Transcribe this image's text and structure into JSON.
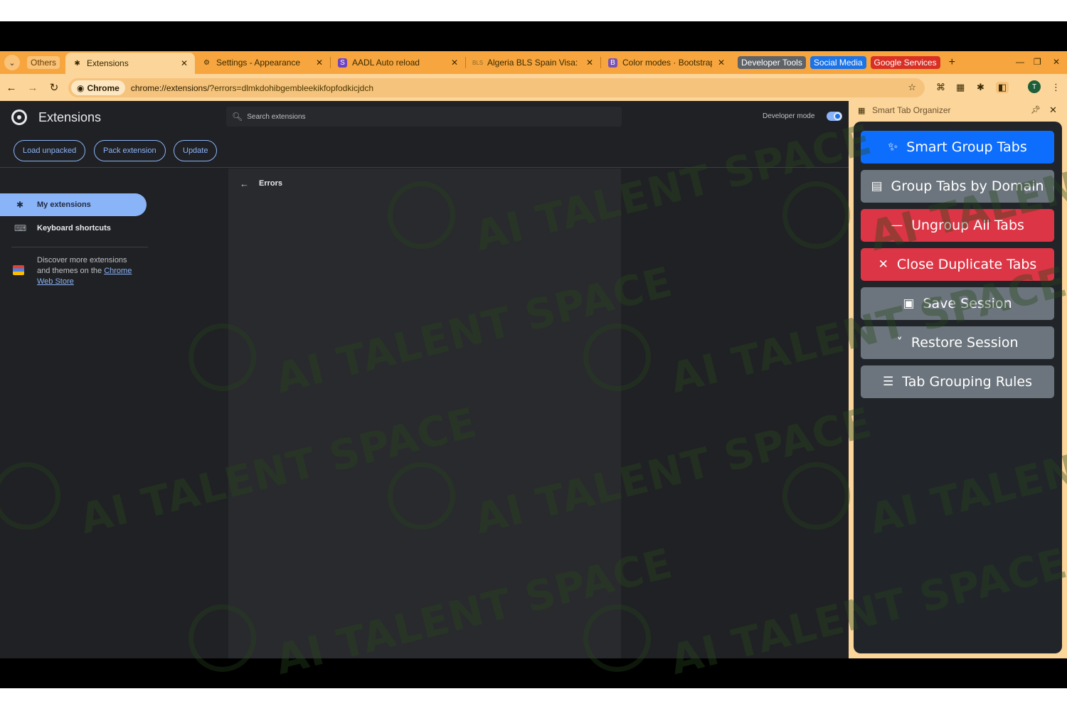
{
  "tabstrip": {
    "groups": {
      "others": "Others",
      "developer_tools": "Developer Tools",
      "social_media": "Social Media",
      "google_services": "Google Services"
    },
    "tabs": [
      {
        "title": "Extensions",
        "active": true
      },
      {
        "title": "Settings - Appearance",
        "active": false
      },
      {
        "title": "AADL Auto reload",
        "active": false
      },
      {
        "title": "Algeria BLS Spain Visa:",
        "active": false
      },
      {
        "title": "Color modes · Bootstrap",
        "active": false
      }
    ]
  },
  "toolbar": {
    "site_chip": "Chrome",
    "url_host": "chrome://extensions/",
    "url_query": "?errors=dlmkdohibgembleekikfopfodkicjdch",
    "avatar_letter": "T"
  },
  "extensions_page": {
    "title": "Extensions",
    "search_placeholder": "Search extensions",
    "developer_mode_label": "Developer mode",
    "developer_mode_on": true,
    "actions": {
      "load_unpacked": "Load unpacked",
      "pack_extension": "Pack extension",
      "update": "Update"
    },
    "nav": {
      "my_extensions": "My extensions",
      "keyboard_shortcuts": "Keyboard shortcuts"
    },
    "discover": {
      "text": "Discover more extensions and themes on the ",
      "link": "Chrome Web Store"
    },
    "errors_title": "Errors"
  },
  "side_panel": {
    "title": "Smart Tab Organizer",
    "buttons": {
      "smart_group": "Smart Group Tabs",
      "group_domain": "Group Tabs by Domain",
      "ungroup": "Ungroup All Tabs",
      "close_duplicates": "Close Duplicate Tabs",
      "save_session": "Save Session",
      "restore_session": "Restore Session",
      "grouping_rules": "Tab Grouping Rules"
    }
  },
  "watermark": {
    "text": "AI TALENT SPACE"
  },
  "colors": {
    "tabstrip": "#f7a53e",
    "toolbar": "#fcd59a",
    "page_bg": "#202124",
    "accent": "#8ab4f8",
    "primary": "#0d6efd",
    "secondary": "#6c757d",
    "danger": "#dc3545"
  }
}
